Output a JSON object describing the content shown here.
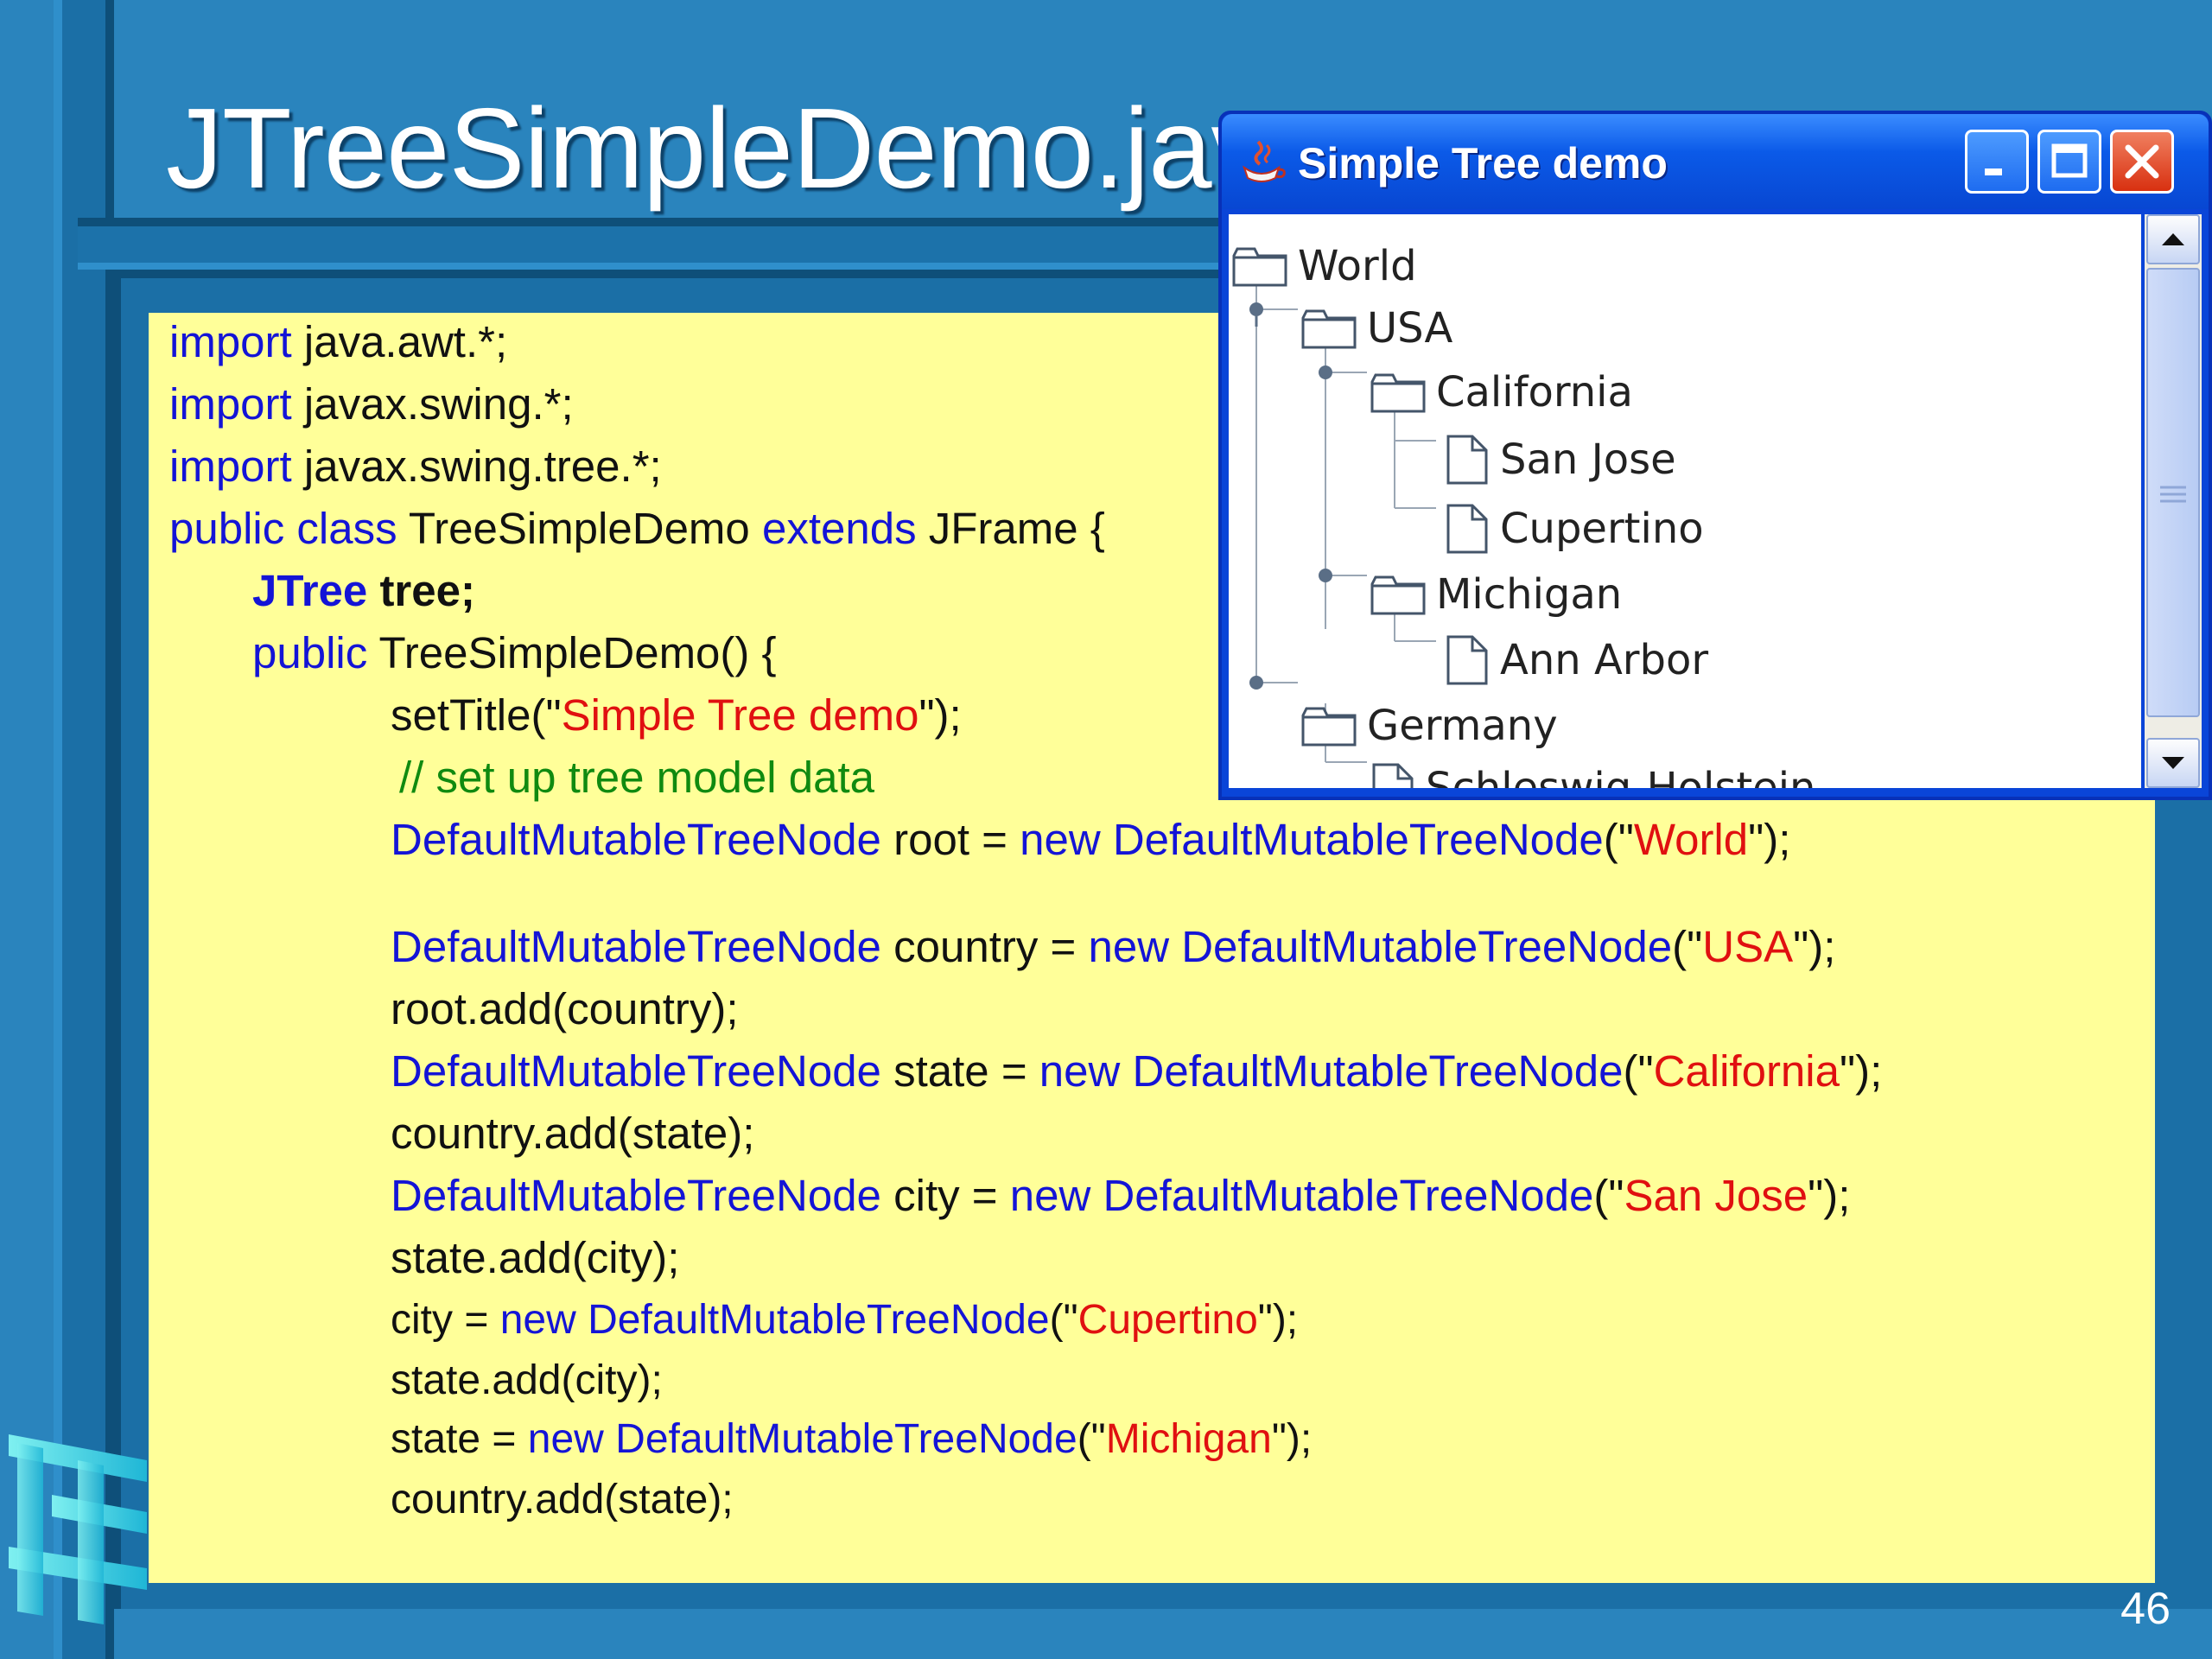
{
  "slide": {
    "title": "JTreeSimpleDemo.java",
    "page_number": "46"
  },
  "code": {
    "l1": {
      "kw": "import",
      "rest": " java.awt.*;"
    },
    "l2": {
      "kw": "import",
      "rest": " javax.swing.*;"
    },
    "l3": {
      "kw": "import",
      "rest": " javax.swing.tree.*;"
    },
    "l4": {
      "kw1": "public class",
      "t1": " TreeSimpleDemo ",
      "kw2": "extends",
      "t2": " JFrame {"
    },
    "l5": {
      "kw": "JTree",
      "rest": " tree;"
    },
    "l6": {
      "kw": "public",
      "rest": " TreeSimpleDemo() {"
    },
    "l7": {
      "t1": "setTitle(\"",
      "str": "Simple Tree demo",
      "t2": "\");"
    },
    "l8": {
      "comment": "// set up tree model data"
    },
    "l9": {
      "kw1": "DefaultMutableTreeNode",
      "t1": " root = ",
      "kw2": "new",
      "t2": " ",
      "kw3": "DefaultMutableTreeNode",
      "t3": "(\"",
      "str": "World",
      "t4": "\");"
    },
    "l10": {
      "kw1": "DefaultMutableTreeNode",
      "t1": " country = ",
      "kw2": "new",
      "t2": " ",
      "kw3": "DefaultMutableTreeNode",
      "t3": "(\"",
      "str": "USA",
      "t4": "\");"
    },
    "l11": {
      "text": "root.add(country);"
    },
    "l12": {
      "kw1": "DefaultMutableTreeNode",
      "t1": " state = ",
      "kw2": "new",
      "t2": " ",
      "kw3": "DefaultMutableTreeNode",
      "t3": "(\"",
      "str": "California",
      "t4": "\");"
    },
    "l13": {
      "text": "country.add(state);"
    },
    "l14": {
      "kw1": "DefaultMutableTreeNode",
      "t1": " city = ",
      "kw2": "new",
      "t2": " ",
      "kw3": "DefaultMutableTreeNode",
      "t3": "(\"",
      "str": "San Jose",
      "t4": "\");"
    },
    "l15": {
      "text": "state.add(city);"
    },
    "l16": {
      "t1": "city = ",
      "kw2": "new",
      "t2": " ",
      "kw3": "DefaultMutableTreeNode",
      "t3": "(\"",
      "str": "Cupertino",
      "t4": "\");"
    },
    "l17": {
      "text": "state.add(city);"
    },
    "l18": {
      "t1": "state = ",
      "kw2": "new",
      "t2": " ",
      "kw3": "DefaultMutableTreeNode",
      "t3": "(\"",
      "str": "Michigan",
      "t4": "\");"
    },
    "l19": {
      "text": "country.add(state);"
    }
  },
  "window": {
    "title": "Simple Tree demo",
    "tree": {
      "world": "World",
      "usa": "USA",
      "california": "California",
      "san_jose": "San Jose",
      "cupertino": "Cupertino",
      "michigan": "Michigan",
      "ann_arbor": "Ann Arbor",
      "germany": "Germany",
      "schleswig": "Schleswig-Holstein"
    },
    "icons": {
      "folder": "folder-icon",
      "leaf": "document-icon",
      "app": "java-cup-icon"
    }
  },
  "colors": {
    "background": "#2a84bd",
    "code_panel": "#ffff99",
    "keyword": "#1414d6",
    "string": "#e01010",
    "comment": "#108a10",
    "titlebar": "#0b5ae8"
  }
}
